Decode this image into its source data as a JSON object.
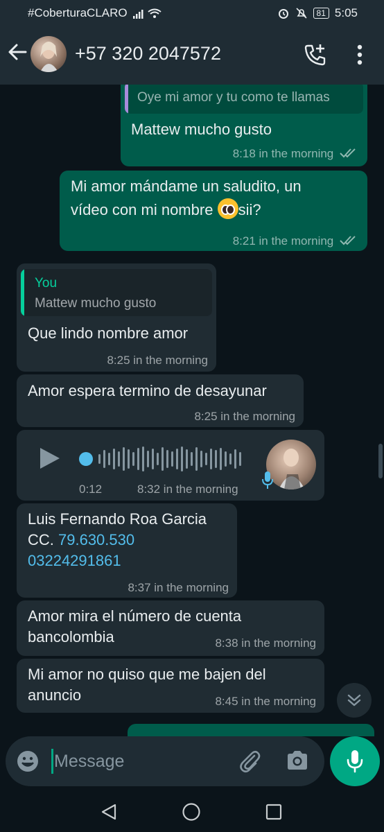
{
  "status_bar": {
    "carrier": "#CoberturaCLARO",
    "battery": "81",
    "clock": "5:05"
  },
  "header": {
    "contact": "+57 320 2047572"
  },
  "messages": [
    {
      "direction": "outgoing",
      "quote_text": "Oye mi amor y tu como te llamas",
      "text": "Mattew mucho gusto",
      "time": "8:18 in the morning",
      "status": "read"
    },
    {
      "direction": "outgoing",
      "line1": "Mi amor mándame un saludito, un",
      "line2_before_emoji": "vídeo con mi nombre",
      "emoji": "pleading-face",
      "line2_after_emoji": "sii?",
      "time": "8:21 in the morning",
      "status": "read"
    },
    {
      "direction": "incoming",
      "quote_author": "You",
      "quote_text": "Mattew mucho gusto",
      "text": "Que lindo nombre amor",
      "time": "8:25 in the morning"
    },
    {
      "direction": "incoming",
      "text": "Amor espera termino de desayunar",
      "time": "8:25 in the morning"
    },
    {
      "direction": "incoming",
      "type": "voice_note",
      "duration": "0:12",
      "time": "8:32 in the morning"
    },
    {
      "direction": "incoming",
      "line1": "Luis Fernando Roa Garcia",
      "cc_prefix": "CC. ",
      "cc_number": "79.630.530",
      "phone": "03224291861",
      "time": "8:37 in the morning"
    },
    {
      "direction": "incoming",
      "line1": "Amor mira el número de cuenta",
      "line2": "bancolombia",
      "time": "8:38 in the morning"
    },
    {
      "direction": "incoming",
      "line1": "Mi amor no quiso que me bajen del",
      "line2": "anuncio",
      "time": "8:45 in the morning"
    }
  ],
  "composer": {
    "placeholder": "Message"
  },
  "colors": {
    "background": "#0b141a",
    "bar": "#1f2c34",
    "outgoing_bubble": "#005c4b",
    "incoming_bubble": "#202c33",
    "accent": "#00a884",
    "read_ticks": "#53bdeb",
    "link": "#53bdeb"
  },
  "icons": [
    "back-arrow-icon",
    "add-call-icon",
    "more-vert-icon",
    "play-icon",
    "mic-icon",
    "emoji-icon",
    "attach-icon",
    "camera-icon",
    "chevron-double-down-icon",
    "nav-back-icon",
    "nav-home-icon",
    "nav-recents-icon"
  ]
}
